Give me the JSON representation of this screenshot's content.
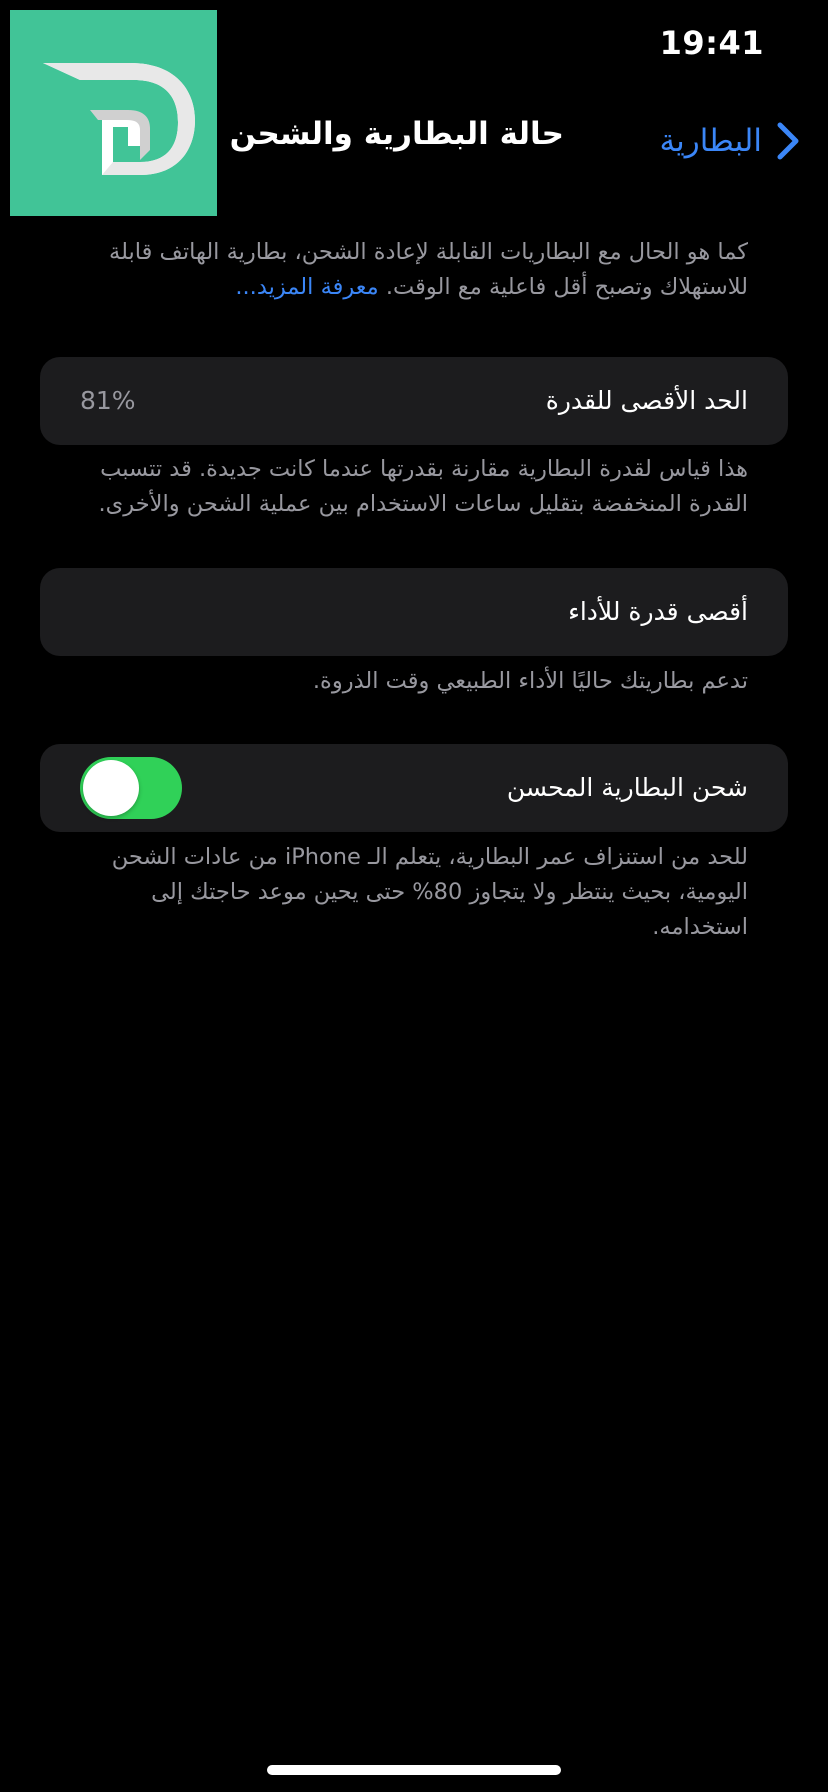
{
  "status_bar": {
    "time": "19:41"
  },
  "nav": {
    "back_label": "البطارية",
    "title": "حالة البطارية والشحن"
  },
  "intro": {
    "text": "كما هو الحال مع البطاريات القابلة لإعادة الشحن، بطارية الهاتف قابلة للاستهلاك وتصبح أقل فاعلية مع الوقت.",
    "learn_more": "معرفة المزيد..."
  },
  "maximum_capacity": {
    "label": "الحد الأقصى للقدرة",
    "value": "81%",
    "footer": "هذا قياس لقدرة البطارية مقارنة بقدرتها عندما كانت جديدة. قد تتسبب القدرة المنخفضة بتقليل ساعات الاستخدام بين عملية الشحن والأخرى."
  },
  "peak_performance": {
    "label": "أقصى قدرة للأداء",
    "footer": "تدعم بطاريتك حاليًا الأداء الطبيعي وقت الذروة."
  },
  "optimized_charging": {
    "label": "شحن البطارية المحسن",
    "enabled": true,
    "footer": "للحد من استنزاف عمر البطارية، يتعلم الـ iPhone من عادات الشحن اليومية، بحيث ينتظر ولا يتجاوز 80% حتى يحين موعد حاجتك إلى استخدامه."
  },
  "colors": {
    "background": "#000000",
    "cell_background": "#1c1c1e",
    "accent_blue": "#3b86f7",
    "toggle_on": "#30d158",
    "secondary_text": "#98989f",
    "logo_background": "#41c497"
  },
  "icons": {
    "back": "chevron-right-icon",
    "logo": "d-logo-icon"
  }
}
